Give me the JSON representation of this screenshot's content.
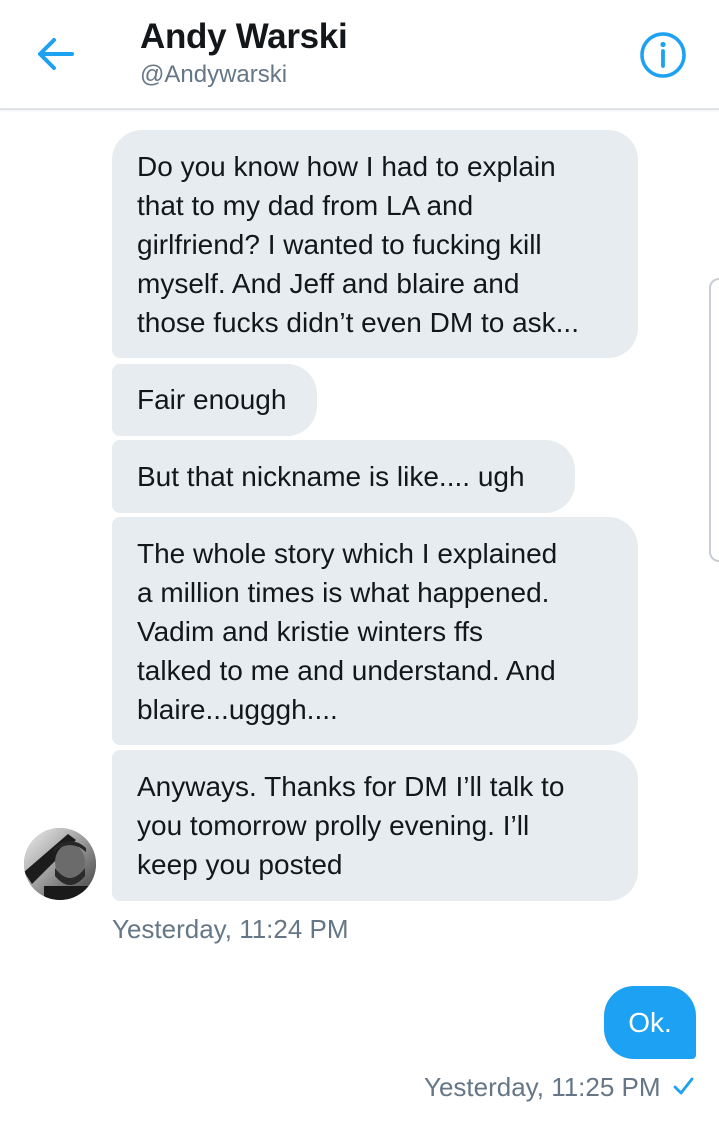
{
  "header": {
    "name": "Andy Warski",
    "handle": "@Andywarski",
    "back_icon": "arrow-left-icon",
    "info_icon": "info-icon",
    "accent": "#1da1f2"
  },
  "conversation": {
    "received": [
      {
        "text": "Do you know how I had to explain\nthat to my dad from LA and\ngirlfriend? I wanted to fucking kill\nmyself. And Jeff and blaire and\nthose fucks didn’t even DM to ask..."
      },
      {
        "text": "Fair enough"
      },
      {
        "text": "But that nickname is like.... ugh"
      },
      {
        "text": "The whole story which I explained\na million times is what happened.\nVadim and kristie winters ffs\ntalked to me and understand. And\nblaire...ugggh...."
      },
      {
        "text": "Anyways. Thanks for DM I’ll talk to\nyou tomorrow prolly evening. I’ll\nkeep you posted"
      }
    ],
    "received_timestamp": "Yesterday, 11:24 PM",
    "sent": [
      {
        "text": "Ok."
      }
    ],
    "sent_timestamp": "Yesterday, 11:25 PM",
    "sent_status_icon": "checkmark-icon",
    "received_bubble_color": "#e6ecf0",
    "sent_bubble_color": "#1da1f2"
  }
}
